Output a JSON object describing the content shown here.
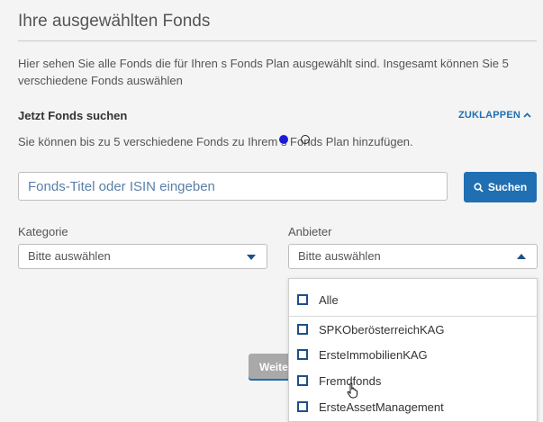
{
  "header": {
    "title": "Ihre ausgewählten Fonds"
  },
  "intro": {
    "text": "Hier sehen Sie alle Fonds die für Ihren s Fonds Plan ausgewählt sind. Insgesamt können Sie 5 verschiedene Fonds auswählen"
  },
  "search_section": {
    "title": "Jetzt Fonds suchen",
    "collapse_label": "ZUKLAPPEN",
    "hint": "Sie können bis zu 5 verschiedene Fonds zu Ihrem s Fonds Plan hinzufügen.",
    "input_placeholder": "Fonds-Titel oder ISIN eingeben",
    "input_value": "",
    "search_button_label": "Suchen"
  },
  "filters": {
    "category": {
      "label": "Kategorie",
      "selected": "Bitte auswählen"
    },
    "provider": {
      "label": "Anbieter",
      "selected": "Bitte auswählen",
      "options": [
        "Alle",
        "SPKOberösterreichKAG",
        "ErsteImmobilienKAG",
        "Fremdfonds",
        "ErsteAssetManagement"
      ]
    }
  },
  "footer": {
    "next_button_label": "Weiter"
  },
  "colors": {
    "accent": "#1f6fb2",
    "checkbox_border": "#1f4f8a",
    "background": "#f4f4f4",
    "disabled_button": "#a9a9a9"
  },
  "icons": {
    "search": "search-icon",
    "collapse": "chevron-up-icon",
    "select_closed": "caret-down-icon",
    "select_open": "caret-up-icon"
  }
}
